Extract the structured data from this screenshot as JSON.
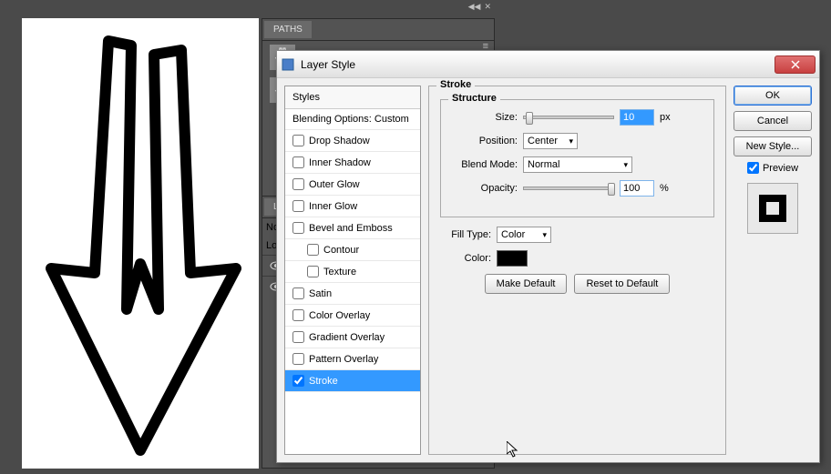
{
  "paths_panel": {
    "tab_label": "PATHS"
  },
  "layers_panel": {
    "tab_label": "LAYERS",
    "mode_prefix": "No",
    "lock_label": "Lo"
  },
  "dialog": {
    "title": "Layer Style",
    "styles_header": "Styles",
    "blending": "Blending Options: Custom",
    "items": {
      "drop_shadow": "Drop Shadow",
      "inner_shadow": "Inner Shadow",
      "outer_glow": "Outer Glow",
      "inner_glow": "Inner Glow",
      "bevel_emboss": "Bevel and Emboss",
      "contour": "Contour",
      "texture": "Texture",
      "satin": "Satin",
      "color_overlay": "Color Overlay",
      "gradient_overlay": "Gradient Overlay",
      "pattern_overlay": "Pattern Overlay",
      "stroke": "Stroke"
    },
    "stroke_title": "Stroke",
    "structure_title": "Structure",
    "size_label": "Size:",
    "size_value": "10",
    "px": "px",
    "position_label": "Position:",
    "position_value": "Center",
    "blend_mode_label": "Blend Mode:",
    "blend_mode_value": "Normal",
    "opacity_label": "Opacity:",
    "opacity_value": "100",
    "percent": "%",
    "fill_type_label": "Fill Type:",
    "fill_type_value": "Color",
    "color_label": "Color:",
    "color_value": "#000000",
    "make_default": "Make Default",
    "reset_default": "Reset to Default",
    "ok": "OK",
    "cancel": "Cancel",
    "new_style": "New Style...",
    "preview": "Preview"
  }
}
